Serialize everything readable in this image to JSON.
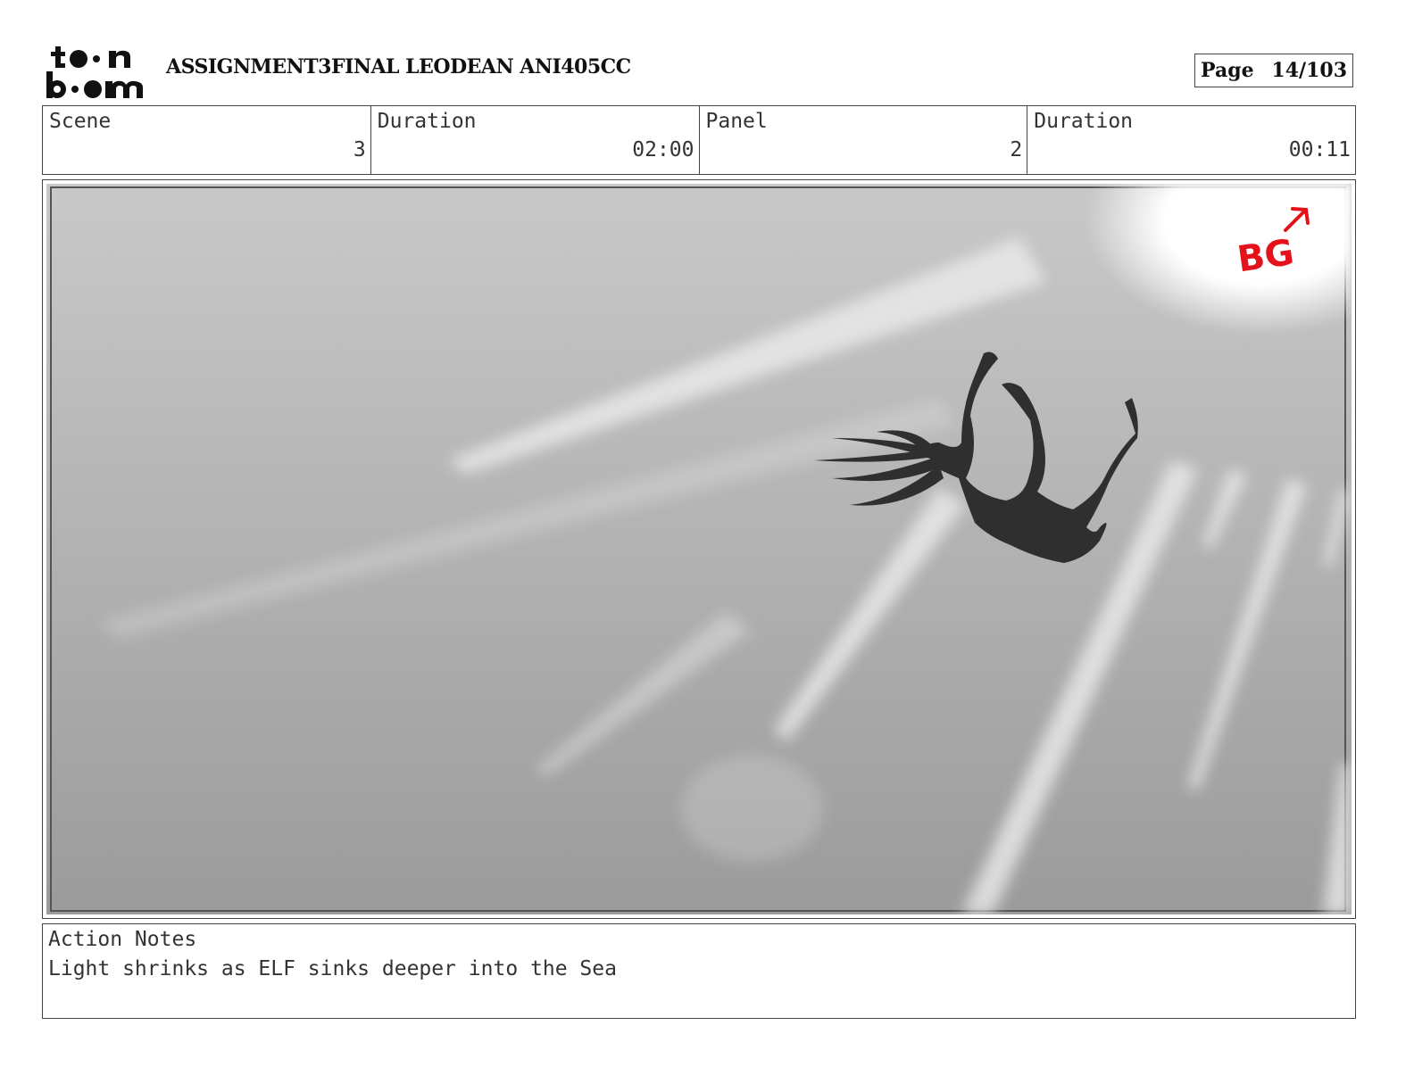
{
  "header": {
    "logo_text_top": "toon",
    "logo_text_bottom": "boom",
    "title": "ASSIGNMENT3FINAL LEODEAN ANI405CC",
    "page_label": "Page",
    "page_value": "14/103"
  },
  "info": [
    {
      "label": "Scene",
      "value": "3"
    },
    {
      "label": "Duration",
      "value": "02:00"
    },
    {
      "label": "Panel",
      "value": "2"
    },
    {
      "label": "Duration",
      "value": "00:11"
    }
  ],
  "panel": {
    "annotation": "BG",
    "annotation_color": "#e3121b",
    "arrow_icon": "arrow-up-right"
  },
  "notes": {
    "label": "Action Notes",
    "text": "Light shrinks as ELF sinks deeper into the Sea"
  }
}
